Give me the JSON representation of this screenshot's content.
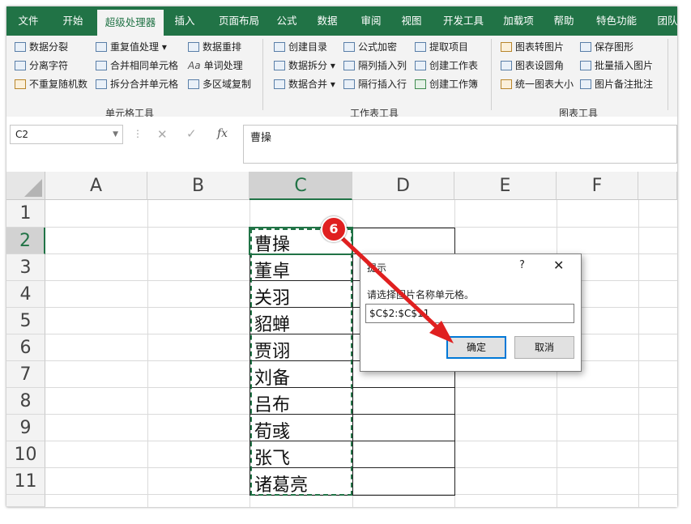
{
  "ribbon": {
    "tabs": [
      "文件",
      "开始",
      "超级处理器",
      "插入",
      "页面布局",
      "公式",
      "数据",
      "审阅",
      "视图",
      "开发工具",
      "加载项",
      "帮助",
      "特色功能",
      "团队"
    ],
    "active_tab": "超级处理器",
    "group1": {
      "buttons": [
        "数据分裂",
        "重复值处理",
        "数据重排",
        "分离字符",
        "合并相同单元格",
        "单词处理",
        "不重复随机数",
        "拆分合并单元格",
        "多区域复制"
      ],
      "label": "单元格工具"
    },
    "group2": {
      "buttons": [
        "创建目录",
        "公式加密",
        "提取项目",
        "数据拆分",
        "隔列插入列",
        "创建工作表",
        "数据合并",
        "隔行插入行",
        "创建工作簿"
      ],
      "label": "工作表工具"
    },
    "group3": {
      "buttons": [
        "图表转图片",
        "保存图形",
        "图表设圆角",
        "批量插入图片",
        "统一图表大小",
        "图片备注批注"
      ],
      "label": "图表工具"
    }
  },
  "formula_bar": {
    "name_box": "C2",
    "fx_label": "fx",
    "content": "曹操"
  },
  "grid": {
    "columns": [
      "A",
      "B",
      "C",
      "D",
      "E",
      "F"
    ],
    "rows": [
      "1",
      "2",
      "3",
      "4",
      "5",
      "6",
      "7",
      "8",
      "9",
      "10",
      "11"
    ],
    "c_values": [
      "曹操",
      "董卓",
      "关羽",
      "貂蝉",
      "贾诩",
      "刘备",
      "吕布",
      "荀彧",
      "张飞",
      "诸葛亮"
    ]
  },
  "dialog": {
    "title": "提示",
    "help": "?",
    "close": "✕",
    "prompt": "请选择图片名称单元格。",
    "input_value": "$C$2:$C$11",
    "ok_label": "确定",
    "cancel_label": "取消"
  },
  "annotation": {
    "step": "6",
    "color": "#e02020"
  },
  "colors": {
    "excel_green": "#217346",
    "dialog_focus": "#0078d7"
  }
}
